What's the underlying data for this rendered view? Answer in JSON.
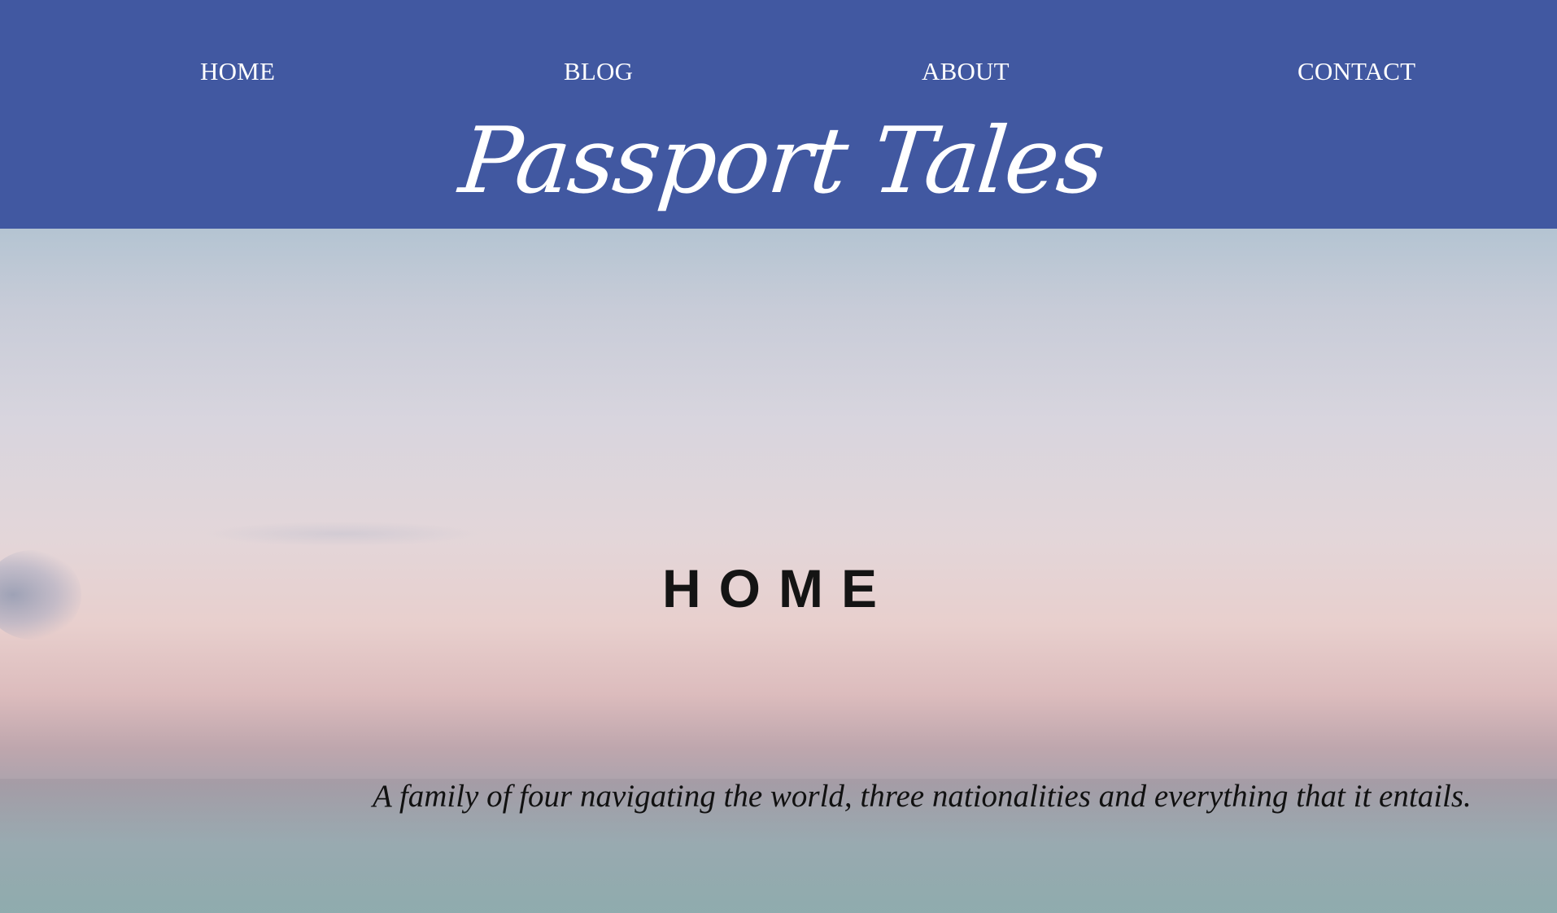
{
  "header": {
    "background_color": "#4158a1",
    "nav": [
      {
        "label": "HOME"
      },
      {
        "label": "BLOG"
      },
      {
        "label": "ABOUT"
      },
      {
        "label": "CONTACT"
      }
    ],
    "brand": "Passport Tales"
  },
  "hero": {
    "title": "HOME",
    "tagline": "A family of four navigating the world, three nationalities and everything that it entails."
  }
}
